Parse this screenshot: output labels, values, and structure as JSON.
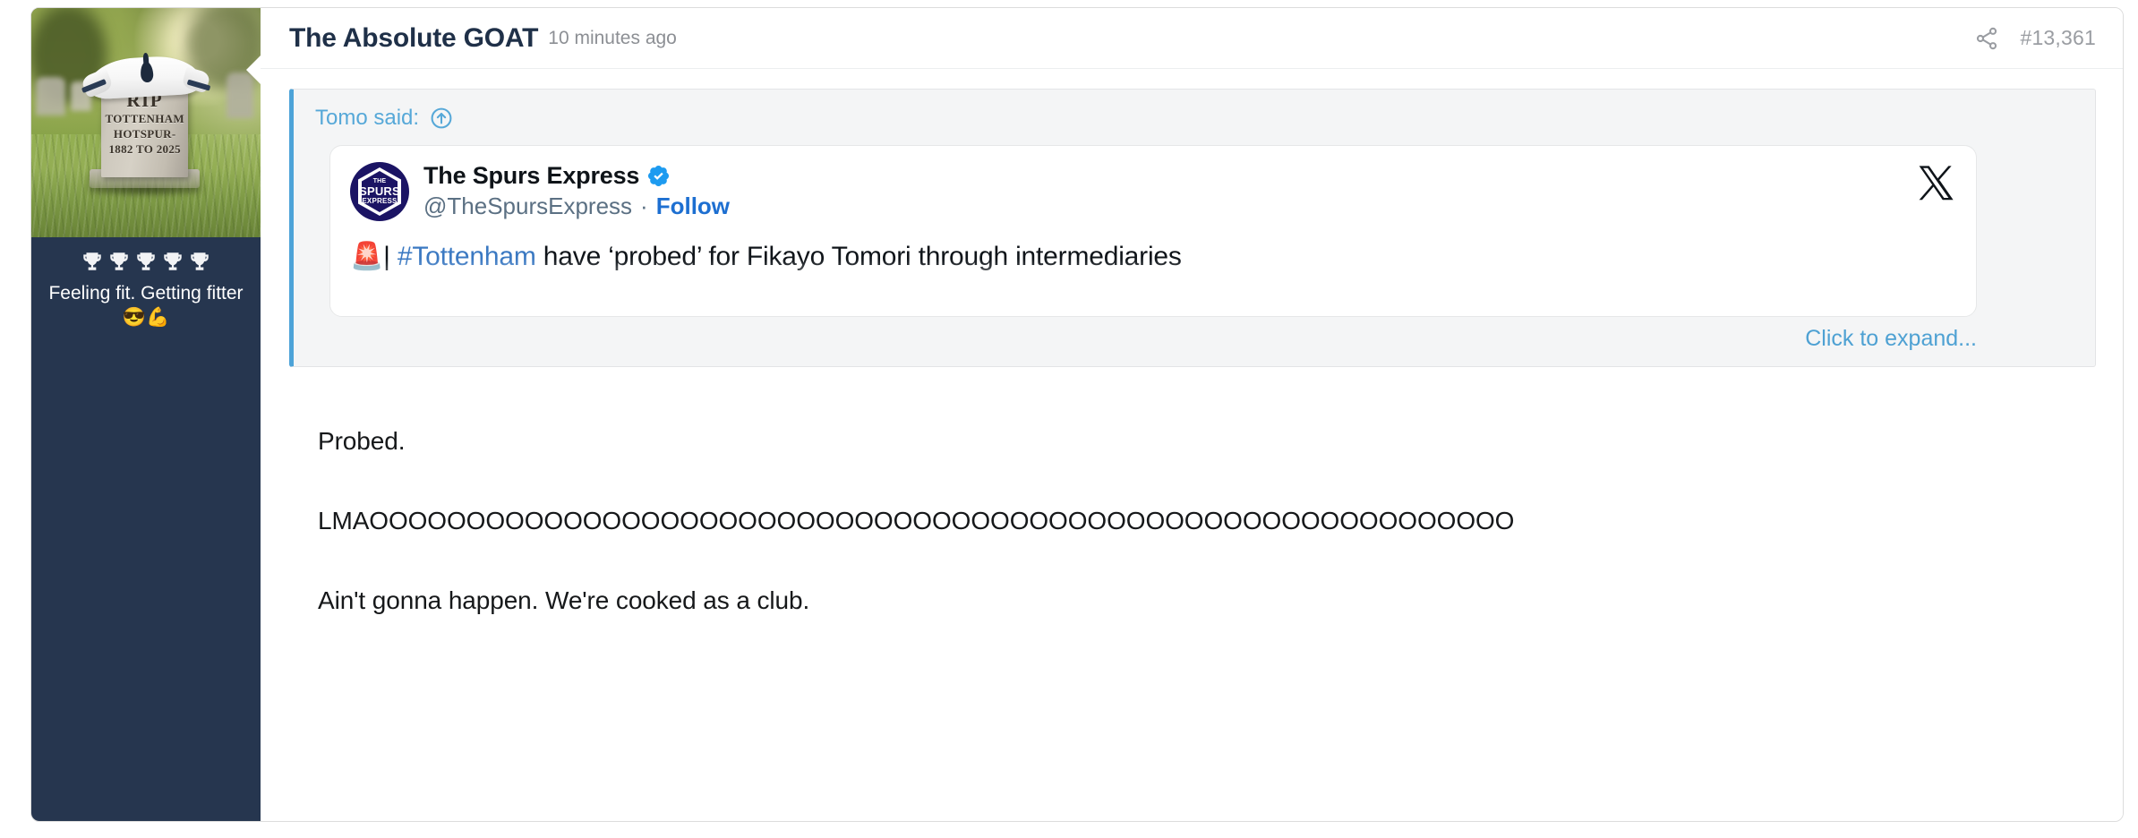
{
  "post": {
    "author": "The Absolute GOAT",
    "timestamp": "10 minutes ago",
    "post_number": "#13,361",
    "share_icon": "share-icon"
  },
  "user_sidebar": {
    "avatar_alt": "Gravestone with Tottenham shirt draped over it",
    "avatar_image_text": {
      "rip": "RIP",
      "line1": "TOTTENHAM",
      "line2": "HOTSPUR-",
      "line3": "1882 TO 2025"
    },
    "trophy_count": 5,
    "trophy_icon": "trophy-icon",
    "user_title": "Feeling fit. Getting fitter 😎💪"
  },
  "blockquote": {
    "attribution": "Tomo said:",
    "jump_icon": "arrow-up-circle-icon",
    "expand_label": "Click to expand...",
    "tweet": {
      "platform_icon": "x-logo-icon",
      "avatar_text_line1": "THE",
      "avatar_text_line2": "SPURS",
      "avatar_text_line3": "EXPRESS",
      "display_name": "The Spurs Express",
      "verified_icon": "verified-badge-icon",
      "handle": "@TheSpursExpress",
      "separator": "·",
      "follow_label": "Follow",
      "text_emoji": "🚨",
      "text_pipe": "| ",
      "hashtag": "#Tottenham",
      "text_rest": " have ‘probed’ for Fikayo Tomori through intermediaries"
    }
  },
  "message": {
    "paragraph1": "Probed.",
    "paragraph2": "LMAOOOOOOOOOOOOOOOOOOOOOOOOOOOOOOOOOOOOOOOOOOOOOOOOOOOOOOOOOOO",
    "paragraph3": "Ain't gonna happen. We're cooked as a club."
  },
  "colors": {
    "sidebar_bg": "#26364f",
    "author_name": "#1f3048",
    "quote_border": "#4da3d8",
    "quote_bg": "#f4f5f6",
    "link_blue": "#56a8d8",
    "hashtag_blue": "#3b79c2",
    "follow_blue": "#1d6fd1",
    "verified_blue": "#1d9bf0",
    "muted_text": "#9a9da2"
  }
}
